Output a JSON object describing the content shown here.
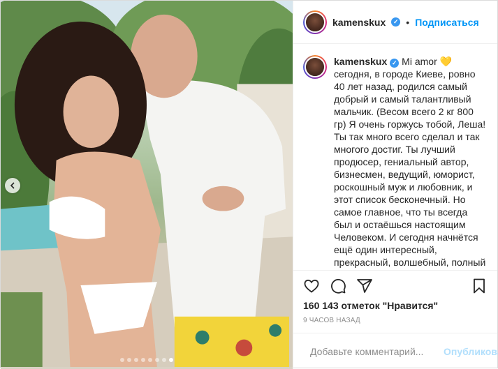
{
  "post": {
    "author": {
      "username": "kamenskux",
      "verified": true
    },
    "follow_label": "Подписаться",
    "separator": "•",
    "caption_text": "Mi amor 💛 сегодня, в городе Киеве, ровно 40 лет назад, родился самый добрый и самый талантливый мальчик. (Весом всего 2 кг 800 гр) Я очень горжусь тобой, Леша! Ты так много всего сделал и так многого достиг. Ты лучший продюсер, гениальный автор, бизнесмен, ведущий, юморист, роскошный муж и любовник, и этот список бесконечный. Но самое главное, что ты всегда был и остаёшься настоящим Человеком. И сегодня начнётся ещё один интересный, прекрасный, волшебный, полный любви и приключений твой Новый год. Зная тебя, ты ворвёшься в него как торнадо и умчишь покорять новые вершины! А я просто буду рядом,",
    "likes_text": "160 143 отметок \"Нравится\"",
    "timestamp": "9 ЧАСОВ НАЗАД",
    "comment_placeholder": "Добавьте комментарий...",
    "publish_label": "Опубликовать",
    "carousel": {
      "total": 8,
      "active_index": 7
    }
  },
  "icons": {
    "prev": "chevron-left-icon",
    "like": "heart-icon",
    "comment": "comment-icon",
    "share": "share-icon",
    "save": "bookmark-icon",
    "emoji": "emoji-icon",
    "verified": "verified-badge-icon"
  },
  "colors": {
    "link_blue": "#0095f6",
    "publish_disabled": "#b2dffc",
    "muted": "#8e8e8e",
    "border": "#dbdbdb"
  }
}
